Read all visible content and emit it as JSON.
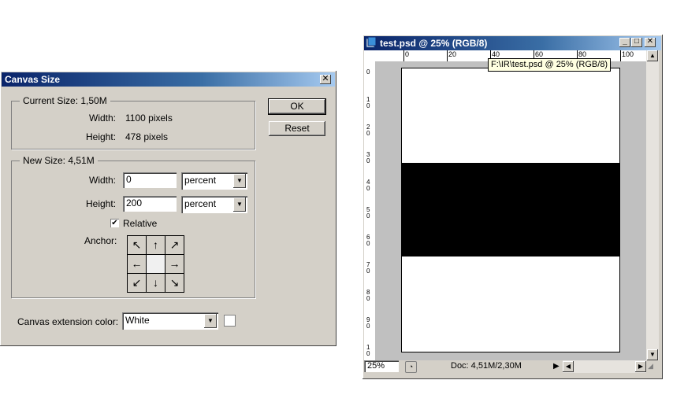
{
  "dialog": {
    "title": "Canvas Size",
    "close_glyph": "✕",
    "current_size": {
      "legend": "Current Size: 1,50M",
      "width_label": "Width:",
      "width_value": "1100 pixels",
      "height_label": "Height:",
      "height_value": "478 pixels"
    },
    "new_size": {
      "legend": "New Size: 4,51M",
      "width_label": "Width:",
      "width_value": "0",
      "width_unit": "percent",
      "height_label": "Height:",
      "height_value": "200",
      "height_unit": "percent",
      "relative_label": "Relative",
      "relative_checked": true,
      "anchor_label": "Anchor:",
      "anchor_arrows": [
        "↖",
        "↑",
        "↗",
        "←",
        "",
        "→",
        "↙",
        "↓",
        "↘"
      ]
    },
    "extension_color_label": "Canvas extension color:",
    "extension_color_value": "White",
    "ok_label": "OK",
    "reset_label": "Reset"
  },
  "document": {
    "title": "test.psd @ 25% (RGB/8)",
    "tooltip": "F:\\IR\\test.psd @ 25% (RGB/8)",
    "ruler_top_labels": [
      "0",
      "20",
      "40",
      "60",
      "80",
      "100"
    ],
    "ruler_left_labels": [
      "0",
      "10",
      "20",
      "30",
      "40",
      "50",
      "60",
      "70",
      "80",
      "90",
      "10"
    ],
    "zoom": "25%",
    "doc_info": "Doc: 4,51M/2,30M",
    "canvas_background": "#ffffff",
    "band_color": "#000000"
  }
}
